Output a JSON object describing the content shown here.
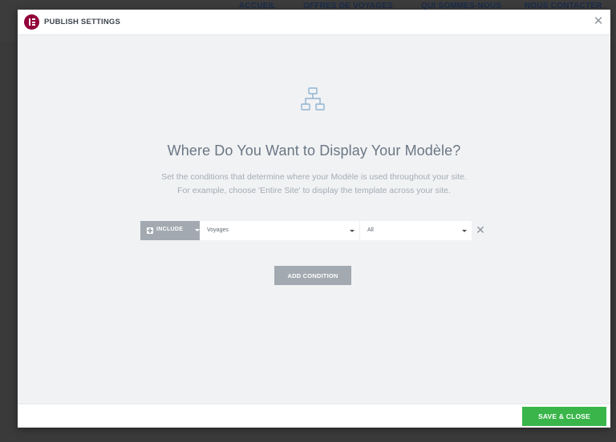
{
  "background": {
    "nav": [
      "ACCUEIL",
      "OFFRES DE VOYAGES",
      "QUI SOMMES-NOUS",
      "NOUS CONTACTER"
    ]
  },
  "modal": {
    "title": "PUBLISH SETTINGS",
    "headline": "Where Do You Want to Display Your Modèle?",
    "subtext_line1": "Set the conditions that determine where your Modèle is used throughout your site.",
    "subtext_line2": "For example, choose 'Entire Site' to display the template across your site.",
    "condition": {
      "include_label": "INCLUDE",
      "type_value": "Voyages",
      "sub_value": "All"
    },
    "add_condition_label": "ADD CONDITION",
    "save_close_label": "SAVE & CLOSE"
  },
  "icons": {
    "logo": "elementor-logo-icon",
    "close": "close-icon",
    "hero": "sitemap-icon",
    "include": "plus-icon",
    "remove": "remove-icon"
  },
  "colors": {
    "brand": "#92003b",
    "save": "#39b54a",
    "muted_button": "#a2a9b0",
    "headline": "#6b7785",
    "subtext": "#a4acb5",
    "hero_icon": "#8fb3d0"
  }
}
